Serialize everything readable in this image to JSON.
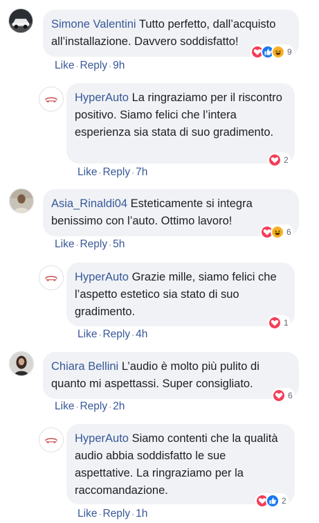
{
  "colors": {
    "author": "#385898",
    "bubble": "#f0f2f5",
    "love": "#f33e58",
    "like": "#1877f2",
    "haha": "#f7b125"
  },
  "comments": [
    {
      "author": "Simone Valentini",
      "text": "Tutto perfetto, dall’acquisto all’installazione. Davvero soddisfatto!",
      "like": "Like",
      "reply": "Reply",
      "time": "9h",
      "reactions": [
        "love",
        "like",
        "haha"
      ],
      "count": "9"
    },
    {
      "author": "HyperAuto",
      "text": "La ringraziamo per il riscontro positivo. Siamo felici che l’intera esperienza sia stata di suo gradimento.",
      "like": "Like",
      "reply": "Reply",
      "time": "7h",
      "reactions": [
        "love"
      ],
      "count": "2"
    },
    {
      "author": "Asia_Rinaldi04",
      "text": "Esteticamente si integra benissimo con l’auto. Ottimo lavoro!",
      "like": "Like",
      "reply": "Reply",
      "time": "5h",
      "reactions": [
        "love",
        "haha"
      ],
      "count": "6"
    },
    {
      "author": "HyperAuto",
      "text": "Grazie mille, siamo felici che l’aspetto estetico sia stato di suo gradimento.",
      "like": "Like",
      "reply": "Reply",
      "time": "4h",
      "reactions": [
        "love"
      ],
      "count": "1"
    },
    {
      "author": "Chiara Bellini",
      "text": "L’audio è molto più pulito di quanto mi aspettassi. Super consigliato.",
      "like": "Like",
      "reply": "Reply",
      "time": "2h",
      "reactions": [
        "love"
      ],
      "count": "6"
    },
    {
      "author": "HyperAuto",
      "text": "Siamo contenti che la qualità audio abbia soddisfatto le sue aspettative. La ringraziamo per la raccomandazione.",
      "like": "Like",
      "reply": "Reply",
      "time": "1h",
      "reactions": [
        "love",
        "like"
      ],
      "count": "2"
    }
  ]
}
